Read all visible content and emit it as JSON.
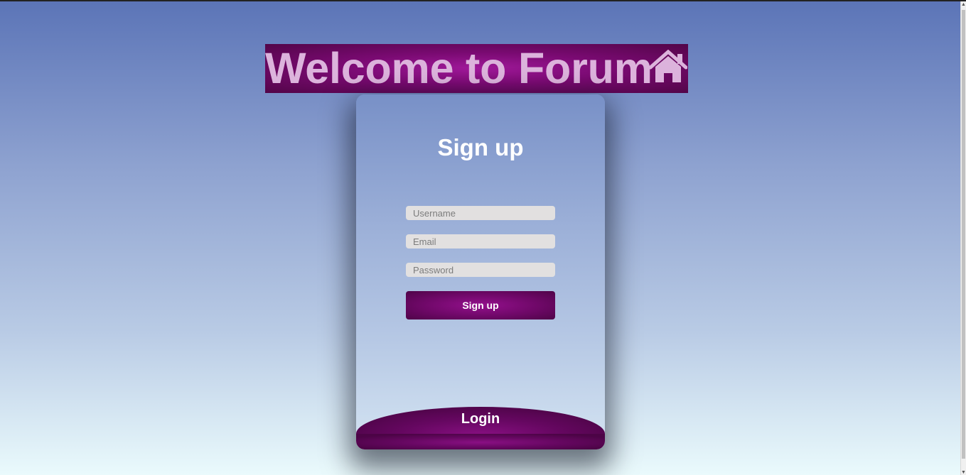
{
  "header": {
    "title": "Welcome to Forum",
    "home_icon": "home-icon"
  },
  "form": {
    "title": "Sign up",
    "username_placeholder": "Username",
    "email_placeholder": "Email",
    "password_placeholder": "Password",
    "submit_label": "Sign up"
  },
  "footer": {
    "login_label": "Login"
  },
  "colors": {
    "accent": "#7a0a72",
    "title_text": "#dcb3dc",
    "background_top": "#5b74b7",
    "background_bottom": "#eafafc",
    "input_bg": "#e2e0e0"
  }
}
